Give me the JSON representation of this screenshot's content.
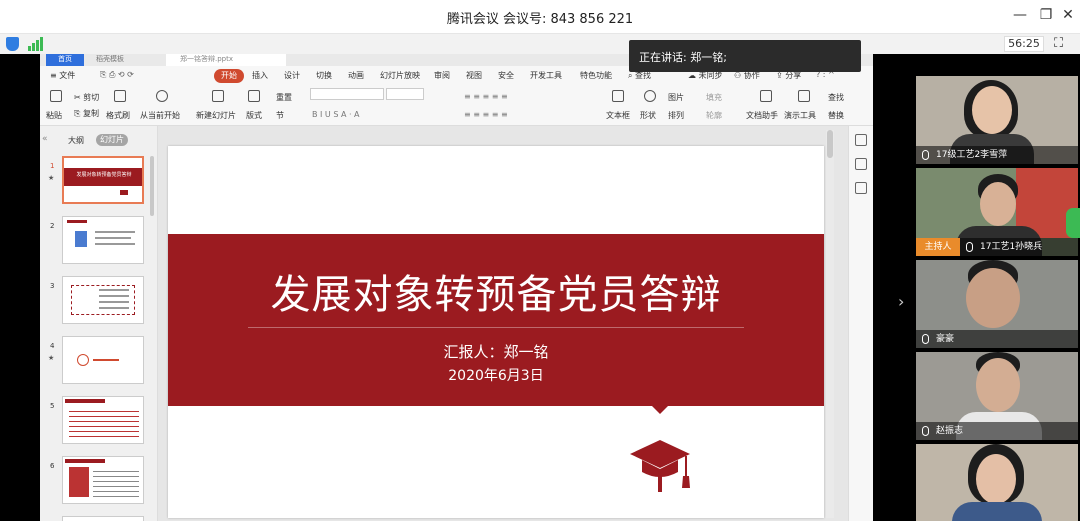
{
  "meeting": {
    "title": "腾讯会议 会议号: 843 856 221",
    "timer": "56:25",
    "speaking": "正在讲话: 郑一铭;"
  },
  "wps": {
    "tabs": {
      "home": "首页",
      "template": "稻壳模板",
      "file": "郑一铭答辩.pptx"
    },
    "menu": [
      "≡ 文件",
      "开始",
      "插入",
      "设计",
      "切换",
      "动画",
      "幻灯片放映",
      "审阅",
      "视图",
      "安全",
      "开发工具",
      "特色功能",
      "查找",
      "未同步",
      "协作",
      "分享"
    ],
    "ribbon": {
      "paste": "粘贴",
      "cut": "剪切",
      "copy": "复制",
      "format_painter": "格式刷",
      "play_from_current": "从当前开始",
      "new_slide": "新建幻灯片",
      "layout": "版式",
      "section": "节",
      "reset": "重置",
      "textbox": "文本框",
      "shape": "形状",
      "picture": "图片",
      "arrange": "排列",
      "outline": "轮廓",
      "fill": "填充",
      "doc_helper": "文档助手",
      "presenter_tools": "演示工具",
      "find": "查找",
      "replace": "替换"
    },
    "panel": {
      "outline": "大纲",
      "slides": "幻灯片"
    },
    "thumbs": [
      {
        "num": "1",
        "title": "发展对象转预备党员答辩"
      },
      {
        "num": "2",
        "title": ""
      },
      {
        "num": "3",
        "title": ""
      },
      {
        "num": "4",
        "title": ""
      },
      {
        "num": "5",
        "title": ""
      },
      {
        "num": "6",
        "title": ""
      }
    ],
    "slide": {
      "title": "发展对象转预备党员答辩",
      "reporter": "汇报人：郑一铭",
      "date": "2020年6月3日"
    }
  },
  "participants": [
    {
      "name": "17级工艺2李雪萍",
      "host": false
    },
    {
      "name": "17工艺1孙晓兵",
      "host": true,
      "host_label": "主持人"
    },
    {
      "name": "豪豪",
      "host": false
    },
    {
      "name": "赵振志",
      "host": false
    },
    {
      "name": "",
      "host": false
    }
  ],
  "colors": {
    "slide_red": "#9b1b20",
    "host_orange": "#e98b2b",
    "accent_blue": "#2f6fdc"
  }
}
